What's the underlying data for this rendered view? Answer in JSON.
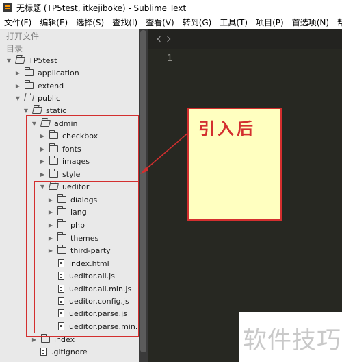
{
  "window": {
    "title": "无标题 (TP5test, itkejiboke) - Sublime Text"
  },
  "menu": {
    "items": [
      "文件(F)",
      "编辑(E)",
      "选择(S)",
      "查找(I)",
      "查看(V)",
      "转到(G)",
      "工具(T)",
      "项目(P)",
      "首选项(N)",
      "帮助"
    ]
  },
  "sidebar": {
    "open_files_label": "打开文件",
    "folders_label": "目录",
    "tree": {
      "root": "TP5test",
      "application": "application",
      "extend": "extend",
      "public": "public",
      "static": "static",
      "admin": "admin",
      "checkbox": "checkbox",
      "fonts": "fonts",
      "images": "images",
      "style": "style",
      "ueditor": "ueditor",
      "dialogs": "dialogs",
      "lang": "lang",
      "php": "php",
      "themes": "themes",
      "third_party": "third-party",
      "index_html": "index.html",
      "ueditor_all": "ueditor.all.js",
      "ueditor_all_min": "ueditor.all.min.js",
      "ueditor_config": "ueditor.config.js",
      "ueditor_parse": "ueditor.parse.js",
      "ueditor_parse_min": "ueditor.parse.min.js",
      "index": "index",
      "gitignore": ".gitignore"
    }
  },
  "editor": {
    "line_number": "1"
  },
  "annotation": {
    "note_text": "引入后",
    "color": "#d32f2f"
  },
  "watermark": {
    "text": "软件技巧"
  }
}
